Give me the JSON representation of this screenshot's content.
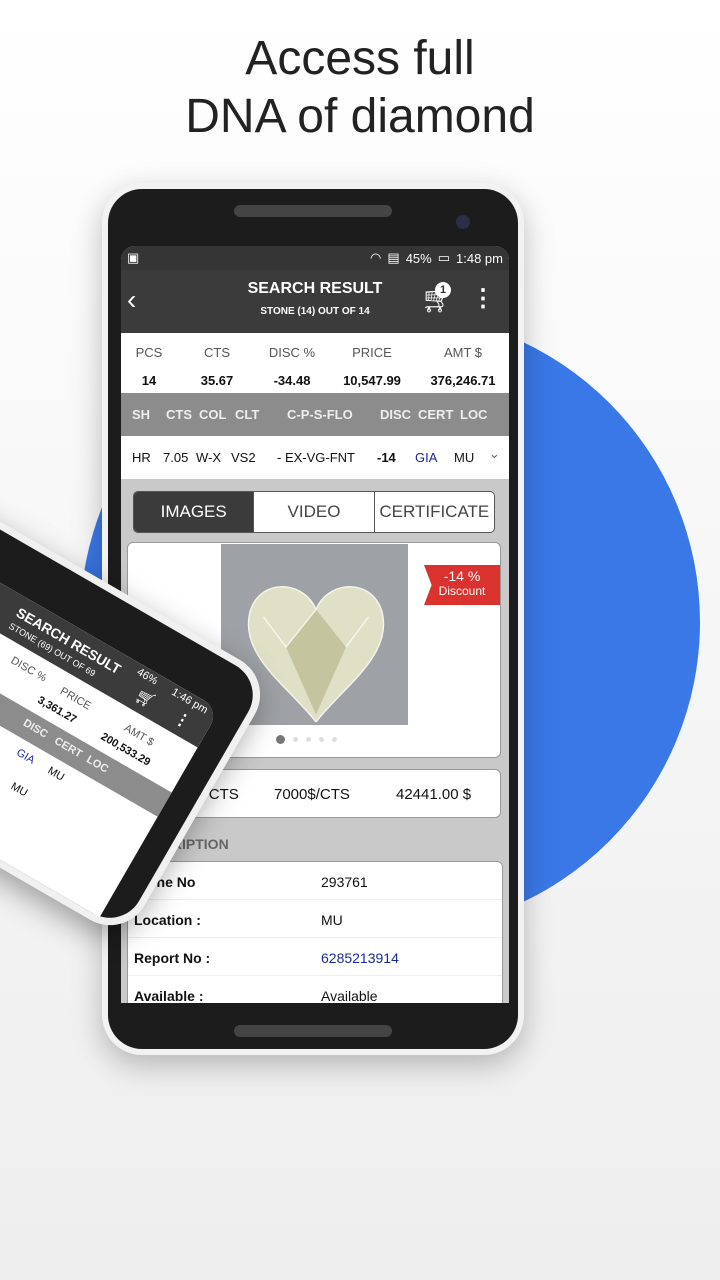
{
  "headline": {
    "line1": "Access full",
    "line2": "DNA of diamond"
  },
  "colors": {
    "accent_blue": "#3a78e8",
    "header": "#3b3b3b",
    "discount_red": "#d9322f",
    "link_blue": "#1a2a9a"
  },
  "status": {
    "battery": "45%",
    "time": "1:48 pm",
    "icons": [
      "gallery-icon",
      "wifi-icon",
      "sd-card-icon",
      "battery-icon"
    ]
  },
  "header": {
    "title": "SEARCH RESULT",
    "subtitle": "STONE (14) OUT OF 14",
    "cart_count": "1"
  },
  "summary": {
    "headers": [
      "PCS",
      "CTS",
      "DISC %",
      "PRICE",
      "AMT $"
    ],
    "values": [
      "14",
      "35.67",
      "-34.48",
      "10,547.99",
      "376,246.71"
    ]
  },
  "columns": [
    "SH",
    "CTS",
    "COL",
    "CLT",
    "C-P-S-FLO",
    "DISC",
    "CERT",
    "LOC"
  ],
  "row": [
    "HR",
    "7.05",
    "W-X",
    "VS2",
    "- EX-VG-FNT",
    "-14",
    "GIA",
    "MU"
  ],
  "tabs": [
    "IMAGES",
    "VIDEO",
    "CERTIFICATE"
  ],
  "discount": {
    "value": "-14 %",
    "label": "Discount"
  },
  "carousel": {
    "count": 5,
    "active": 1
  },
  "prices": [
    "6020.00$/CTS",
    "7000$/CTS",
    "42441.00 $"
  ],
  "description": {
    "title": "DESCRIPTION",
    "rows": [
      {
        "k": "Stone No",
        "v": "293761"
      },
      {
        "k": "Location :",
        "v": "MU"
      },
      {
        "k": "Report No :",
        "v": "6285213914"
      },
      {
        "k": "Available :",
        "v": "Available"
      }
    ]
  },
  "phone2": {
    "title": "SEARCH RESULT",
    "subtitle": "STONE (69) OUT OF 69",
    "battery": "46%",
    "time": "1:46 pm",
    "disc_header": "DISC %",
    "price_header": "PRICE",
    "amt_header": "AMT $",
    "price": "3,361.27",
    "amt": "200,533.29",
    "cols": [
      "DISC",
      "CERT",
      "LOC"
    ],
    "cert": "GIA",
    "loc1": "MU",
    "loc2": "MU"
  }
}
